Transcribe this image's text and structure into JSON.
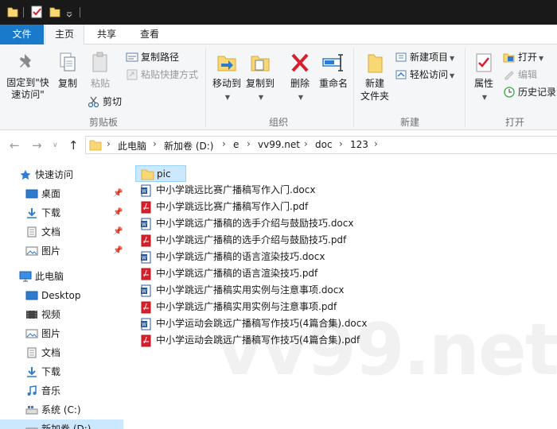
{
  "tabs": {
    "file": "文件",
    "home": "主页",
    "share": "共享",
    "view": "查看"
  },
  "ribbon": {
    "clipboard": {
      "pin_quick_access": "固定到\"快速访问\"",
      "copy": "复制",
      "paste": "粘贴",
      "copy_path": "复制路径",
      "paste_shortcut": "粘贴快捷方式",
      "cut": "剪切",
      "group_label": "剪贴板"
    },
    "organize": {
      "move_to": "移动到",
      "copy_to": "复制到",
      "delete": "删除",
      "rename": "重命名",
      "group_label": "组织"
    },
    "new": {
      "new_folder": "新建\n文件夹",
      "new_item": "新建项目",
      "easy_access": "轻松访问",
      "group_label": "新建"
    },
    "open": {
      "properties": "属性",
      "open": "打开",
      "edit": "编辑",
      "history": "历史记录",
      "group_label": "打开"
    }
  },
  "address": {
    "breadcrumb": [
      "此电脑",
      "新加卷 (D:)",
      "e",
      "vv99.net",
      "doc",
      "123"
    ]
  },
  "navpane": {
    "quick_access": "快速访问",
    "quick_items": [
      "桌面",
      "下载",
      "文档",
      "图片"
    ],
    "this_pc": "此电脑",
    "pc_items": [
      "Desktop",
      "视频",
      "图片",
      "文档",
      "下载",
      "音乐",
      "系统 (C:)",
      "新加卷 (D:)"
    ]
  },
  "files": [
    {
      "name": "pic",
      "type": "folder"
    },
    {
      "name": "中小学跳远比赛广播稿写作入门.docx",
      "type": "docx"
    },
    {
      "name": "中小学跳远比赛广播稿写作入门.pdf",
      "type": "pdf"
    },
    {
      "name": "中小学跳远广播稿的选手介绍与鼓励技巧.docx",
      "type": "docx"
    },
    {
      "name": "中小学跳远广播稿的选手介绍与鼓励技巧.pdf",
      "type": "pdf"
    },
    {
      "name": "中小学跳远广播稿的语言渲染技巧.docx",
      "type": "docx"
    },
    {
      "name": "中小学跳远广播稿的语言渲染技巧.pdf",
      "type": "pdf"
    },
    {
      "name": "中小学跳远广播稿实用实例与注意事项.docx",
      "type": "docx"
    },
    {
      "name": "中小学跳远广播稿实用实例与注意事项.pdf",
      "type": "pdf"
    },
    {
      "name": "中小学运动会跳远广播稿写作技巧(4篇合集).docx",
      "type": "docx"
    },
    {
      "name": "中小学运动会跳远广播稿写作技巧(4篇合集).pdf",
      "type": "pdf"
    }
  ],
  "watermark": "vv99.net",
  "colors": {
    "accent": "#1979ca",
    "selection": "#cce8ff",
    "titlebar": "#191919",
    "folder": "#f8d775",
    "pdf": "#d7202c",
    "docx": "#2b5797"
  }
}
